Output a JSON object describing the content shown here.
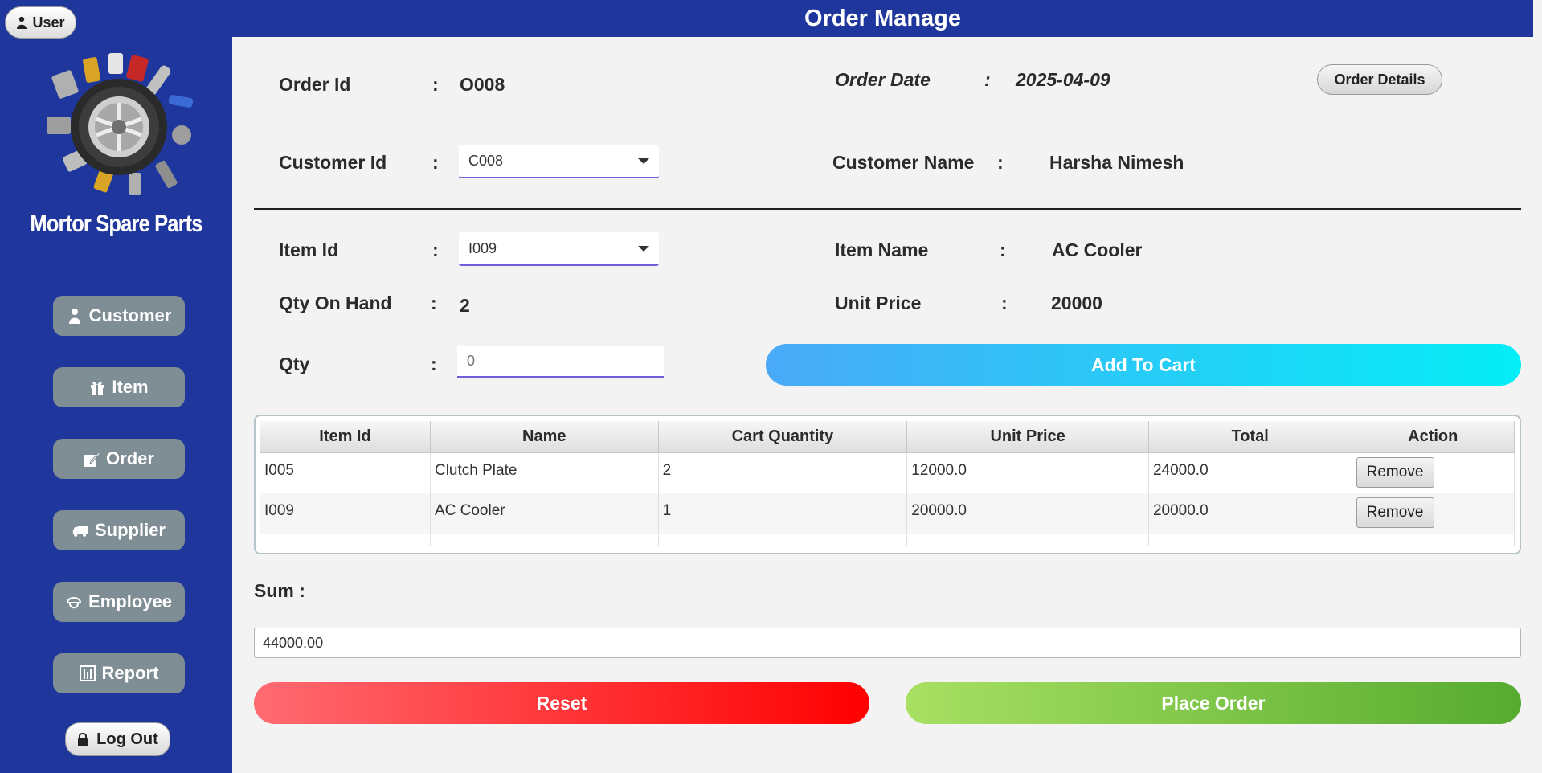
{
  "sidebar": {
    "user_label": "User",
    "brand": "Mortor Spare Parts",
    "nav": [
      {
        "label": "Customer",
        "icon": "person-icon"
      },
      {
        "label": "Item",
        "icon": "gift-icon"
      },
      {
        "label": "Order",
        "icon": "order-icon"
      },
      {
        "label": "Supplier",
        "icon": "truck-icon"
      },
      {
        "label": "Employee",
        "icon": "helmet-icon"
      },
      {
        "label": "Report",
        "icon": "report-icon"
      }
    ],
    "logout_label": "Log Out"
  },
  "header": {
    "title": "Order Manage"
  },
  "form": {
    "colon": ":",
    "order_id_label": "Order Id",
    "order_id": "O008",
    "order_date_label": "Order Date",
    "order_date": "2025-04-09",
    "order_details_label": "Order Details",
    "customer_id_label": "Customer Id",
    "customer_id": "C008",
    "customer_name_label": "Customer Name",
    "customer_name": "Harsha Nimesh",
    "item_id_label": "Item Id",
    "item_id": "I009",
    "item_name_label": "Item Name",
    "item_name": "AC Cooler",
    "qty_on_hand_label": "Qty On Hand",
    "qty_on_hand": "2",
    "unit_price_label": "Unit Price",
    "unit_price": "20000",
    "qty_label": "Qty",
    "qty_placeholder": "0",
    "add_to_cart_label": "Add To Cart"
  },
  "cart": {
    "columns": [
      "Item Id",
      "Name",
      "Cart Quantity",
      "Unit Price",
      "Total",
      "Action"
    ],
    "rows": [
      {
        "item_id": "I005",
        "name": "Clutch Plate",
        "qty": "2",
        "unit_price": "12000.0",
        "total": "24000.0",
        "action": "Remove"
      },
      {
        "item_id": "I009",
        "name": "AC Cooler",
        "qty": "1",
        "unit_price": "20000.0",
        "total": "20000.0",
        "action": "Remove"
      }
    ]
  },
  "summary": {
    "sum_label": "Sum :",
    "sum_value": "44000.00",
    "reset_label": "Reset",
    "place_order_label": "Place Order"
  },
  "colors": {
    "sidebar_bg": "#1f379c",
    "nav_button": "#7f8d94",
    "add_to_cart": "#04eef6",
    "reset": "#ff0000",
    "place_order": "#56ab2f"
  }
}
